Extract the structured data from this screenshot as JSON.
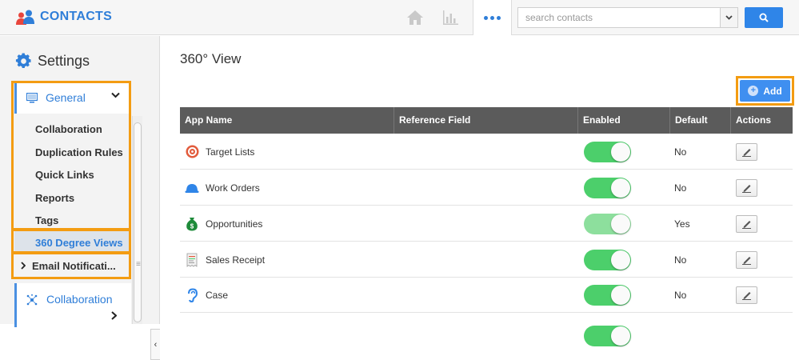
{
  "header": {
    "brand_title": "CONTACTS",
    "brand_icon": "contacts-people-icon",
    "nav_icons": [
      "home-icon",
      "stats-icon",
      "more-dots-icon"
    ],
    "search": {
      "placeholder": "search contacts",
      "value": ""
    },
    "search_button_icon": "search-icon"
  },
  "sidebar": {
    "title": "Settings",
    "title_icon": "gear-icon",
    "general": {
      "label": "General",
      "icon": "monitor-icon",
      "items": [
        {
          "label": "Collaboration"
        },
        {
          "label": "Duplication Rules"
        },
        {
          "label": "Quick Links"
        },
        {
          "label": "Reports"
        },
        {
          "label": "Tags"
        },
        {
          "label": "360 Degree Views",
          "active": true
        }
      ]
    },
    "email_notifications": {
      "label": "Email Notificati..."
    },
    "collaboration": {
      "label": "Collaboration",
      "icon": "network-icon"
    }
  },
  "main": {
    "title": "360° View",
    "add_button": "Add",
    "columns": {
      "app_name": "App Name",
      "reference_field": "Reference Field",
      "enabled": "Enabled",
      "default": "Default",
      "actions": "Actions"
    },
    "rows": [
      {
        "app": "Target Lists",
        "icon": "target-icon",
        "reference": "",
        "enabled": true,
        "default": "No"
      },
      {
        "app": "Work Orders",
        "icon": "helmet-icon",
        "reference": "",
        "enabled": true,
        "default": "No"
      },
      {
        "app": "Opportunities",
        "icon": "money-bag-icon",
        "reference": "",
        "enabled": true,
        "default": "Yes"
      },
      {
        "app": "Sales Receipt",
        "icon": "receipt-icon",
        "reference": "",
        "enabled": true,
        "default": "No"
      },
      {
        "app": "Case",
        "icon": "ear-icon",
        "reference": "",
        "enabled": true,
        "default": "No"
      }
    ]
  },
  "colors": {
    "brand_blue": "#2f7ed8",
    "highlight_orange": "#f39c12",
    "toggle_green": "#4ccf6b",
    "header_gray": "#5b5b5b"
  }
}
